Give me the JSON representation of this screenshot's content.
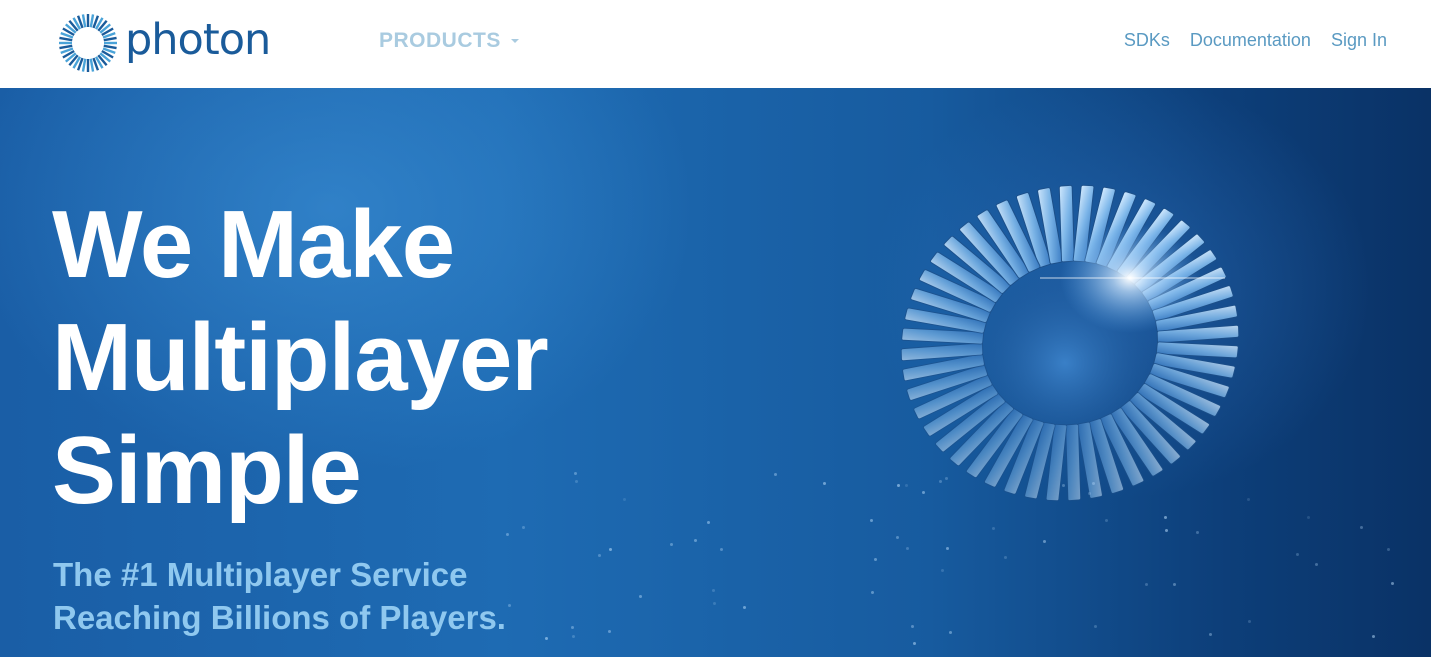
{
  "header": {
    "logo_text": "photon",
    "logo_icon": "photon-ring-logo-icon",
    "nav_products": "PRODUCTS",
    "nav_products_icon": "caret-down-icon",
    "links": [
      "SDKs",
      "Documentation",
      "Sign In"
    ]
  },
  "hero": {
    "title_lines": [
      "We Make",
      "Multiplayer",
      "Simple"
    ],
    "subtitle_lines": [
      "The #1 Multiplayer Service",
      "Reaching Billions of Players."
    ],
    "art_icon": "gear-ring-illustration"
  },
  "colors": {
    "brand_blue": "#1a5b9a",
    "hero_blue": "#1e6bb3",
    "subtitle_blue": "#8fc8ef",
    "nav_link": "#5a9ac2",
    "products_label": "#a9cbe0"
  }
}
